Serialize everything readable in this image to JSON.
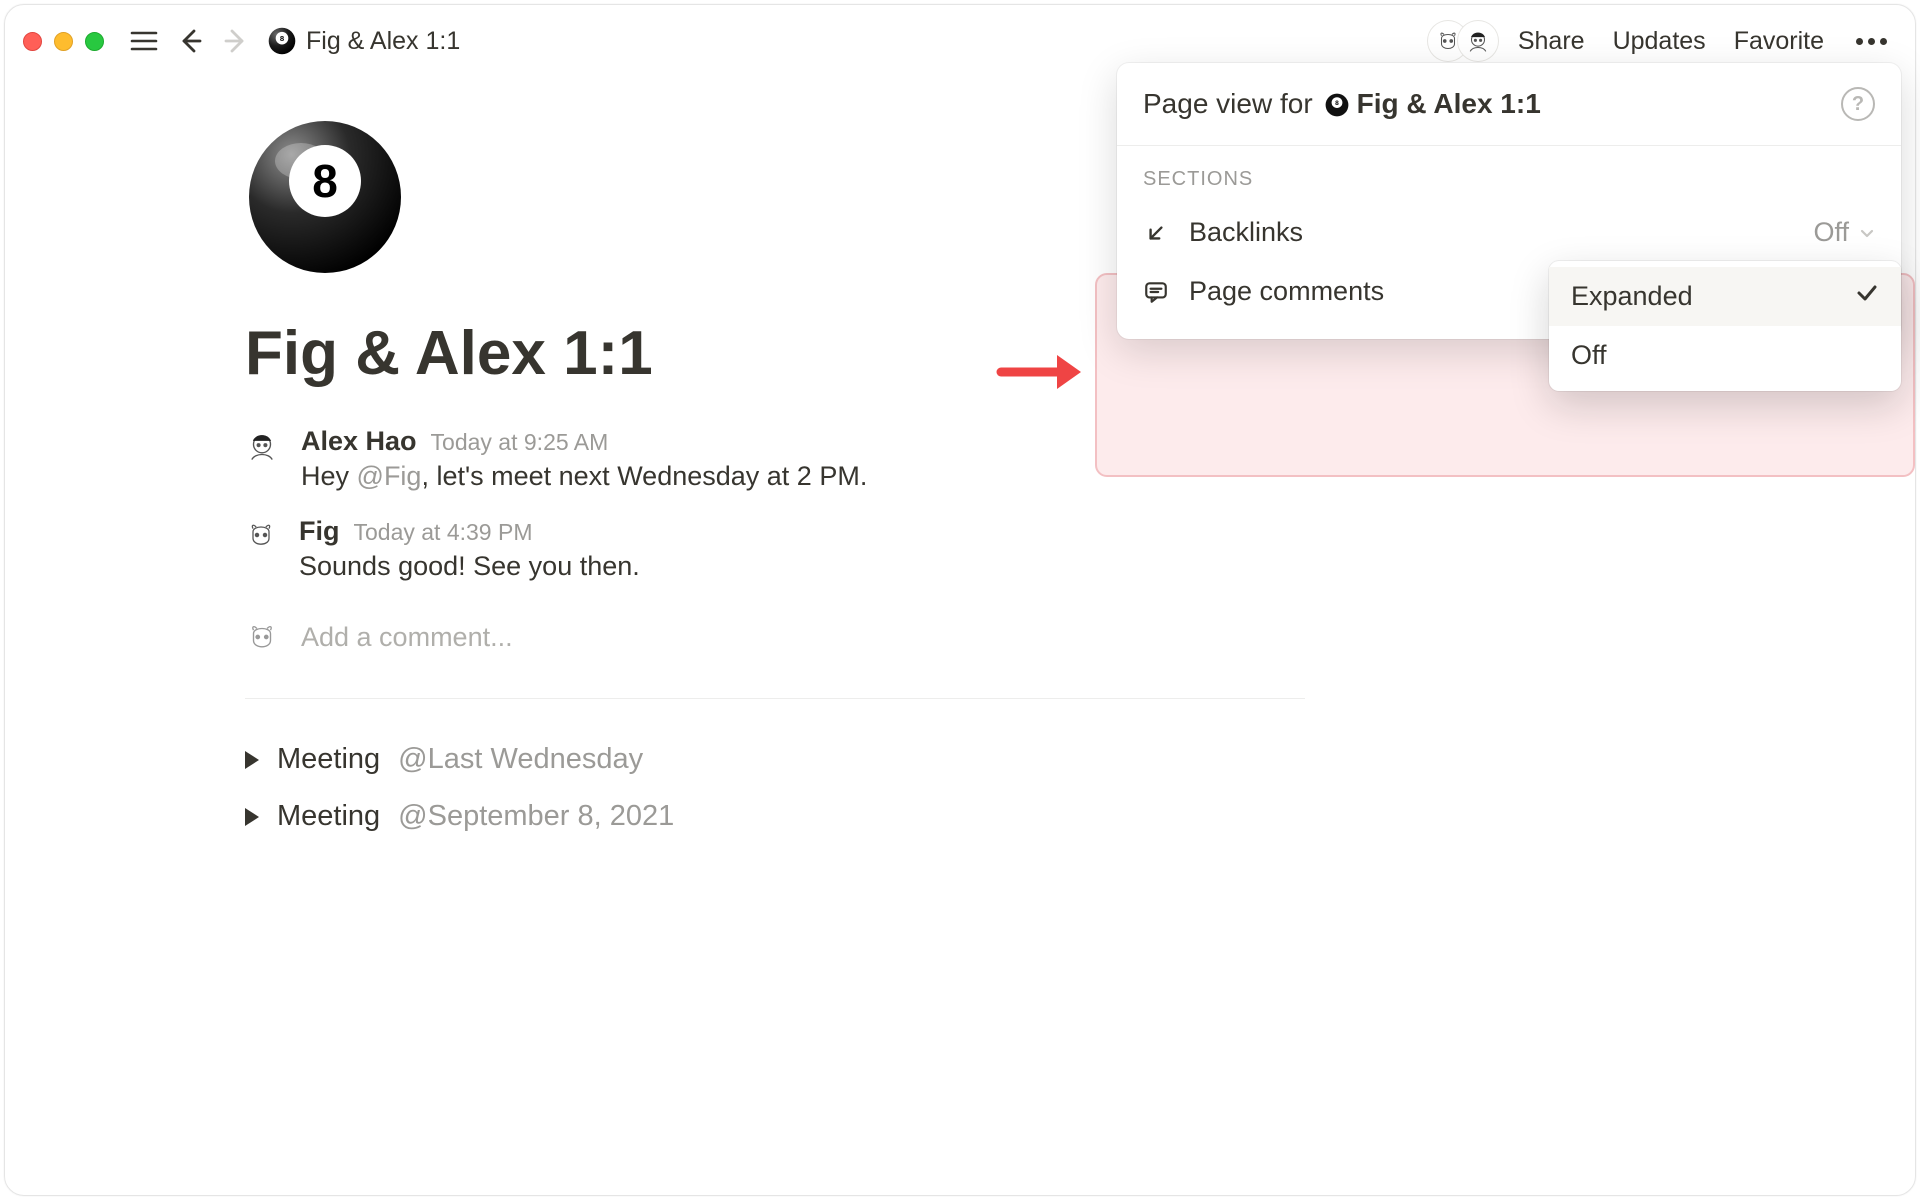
{
  "topbar": {
    "breadcrumb_title": "Fig & Alex 1:1",
    "share": "Share",
    "updates": "Updates",
    "favorite": "Favorite"
  },
  "page": {
    "title": "Fig & Alex 1:1"
  },
  "comments": [
    {
      "author": "Alex Hao",
      "time": "Today at 9:25 AM",
      "text_before": "Hey ",
      "mention": "@Fig",
      "text_after": ", let's meet next Wednesday at 2 PM."
    },
    {
      "author": "Fig",
      "time": "Today at 4:39 PM",
      "text_before": "Sounds good! See you then.",
      "mention": "",
      "text_after": ""
    }
  ],
  "add_comment_placeholder": "Add a comment...",
  "meetings": [
    {
      "label": "Meeting",
      "date": "@Last Wednesday"
    },
    {
      "label": "Meeting",
      "date": "@September 8, 2021"
    }
  ],
  "popover": {
    "prefix": "Page view for",
    "page_title": "Fig & Alex 1:1",
    "sections_label": "SECTIONS",
    "rows": {
      "backlinks": {
        "label": "Backlinks",
        "value": "Off"
      },
      "page_comments": {
        "label": "Page comments",
        "value": "Expanded"
      }
    }
  },
  "submenu": {
    "expanded": "Expanded",
    "off": "Off"
  }
}
